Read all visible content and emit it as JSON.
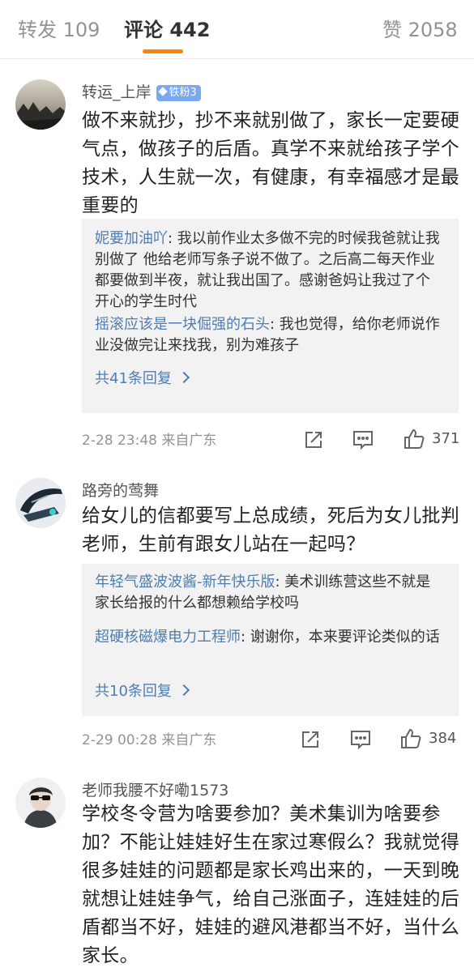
{
  "tabs": {
    "repost": "转发 109",
    "comments": "评论 442",
    "likes": "赞 2058",
    "active_color": "#ff8200"
  },
  "comments": [
    {
      "username": "转运_上岸",
      "badge": "铁粉3",
      "text": "做不来就抄，抄不来就别做了，家长一定要硬气点，做孩子的后盾。真学不来就给孩子学个技术，人生就一次，有健康，有幸福感才是最重要的",
      "replies": [
        {
          "user": "妮要加油吖",
          "text": ": 我以前作业太多做不完的时候我爸就让我别做了 他给老师写条子说不做了。之后高二每天作业都要做到半夜，就让我出国了。感谢爸妈让我过了个开心的学生时代"
        },
        {
          "user": "摇滚应该是一块倔强的石头",
          "text": ": 我也觉得，给你老师说作业没做完让来找我，别为难孩子"
        }
      ],
      "more_replies": "共41条回复",
      "meta": "2-28 23:48  来自广东",
      "like_count": "371"
    },
    {
      "username": "路旁的莺舞",
      "text": "给女儿的信都要写上总成绩，死后为女儿批判老师，生前有跟女儿站在一起吗？",
      "replies": [
        {
          "user": "年轻气盛波波酱-新年快乐版",
          "text": ": 美术训练营这些不就是家长给报的什么都想赖给学校吗"
        },
        {
          "user": "超硬核磁爆电力工程师",
          "text": ": 谢谢你，本来要评论类似的话"
        }
      ],
      "more_replies": "共10条回复",
      "meta": "2-29 00:28  来自广东",
      "like_count": "384"
    },
    {
      "username": "老师我腰不好嘞1573",
      "text": "学校冬令营为啥要参加？美术集训为啥要参加？不能让娃娃好生在家过寒假么？我就觉得很多娃娃的问题都是家长鸡出来的，一天到晚就想让娃娃争气，给自己涨面子，连娃娃的后盾都当不好，娃娃的避风港都当不好，当什么家长。"
    }
  ],
  "icons": {
    "repost": "share-icon",
    "comment": "comment-icon",
    "like": "thumbs-up-icon"
  },
  "colors": {
    "link": "#507daf",
    "badge": "#7aa8f3",
    "reply_bg": "#f2f2f2"
  }
}
